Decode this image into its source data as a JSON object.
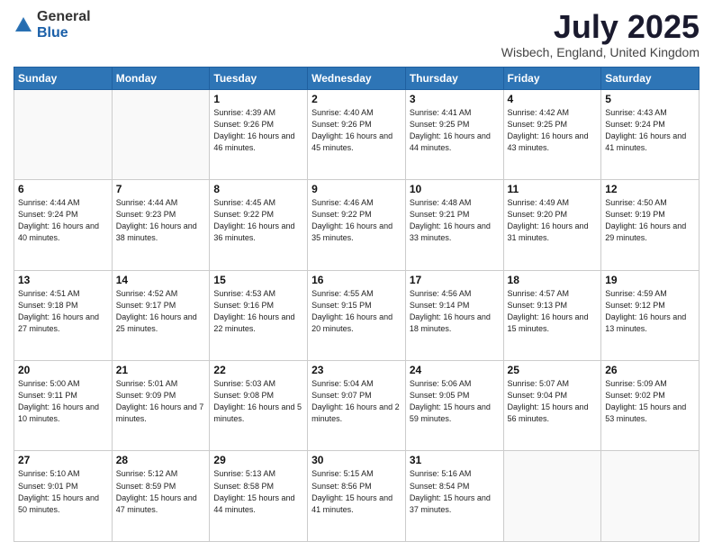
{
  "header": {
    "logo_general": "General",
    "logo_blue": "Blue",
    "title": "July 2025",
    "location": "Wisbech, England, United Kingdom"
  },
  "weekdays": [
    "Sunday",
    "Monday",
    "Tuesday",
    "Wednesday",
    "Thursday",
    "Friday",
    "Saturday"
  ],
  "weeks": [
    [
      {
        "day": "",
        "info": ""
      },
      {
        "day": "",
        "info": ""
      },
      {
        "day": "1",
        "info": "Sunrise: 4:39 AM\nSunset: 9:26 PM\nDaylight: 16 hours\nand 46 minutes."
      },
      {
        "day": "2",
        "info": "Sunrise: 4:40 AM\nSunset: 9:26 PM\nDaylight: 16 hours\nand 45 minutes."
      },
      {
        "day": "3",
        "info": "Sunrise: 4:41 AM\nSunset: 9:25 PM\nDaylight: 16 hours\nand 44 minutes."
      },
      {
        "day": "4",
        "info": "Sunrise: 4:42 AM\nSunset: 9:25 PM\nDaylight: 16 hours\nand 43 minutes."
      },
      {
        "day": "5",
        "info": "Sunrise: 4:43 AM\nSunset: 9:24 PM\nDaylight: 16 hours\nand 41 minutes."
      }
    ],
    [
      {
        "day": "6",
        "info": "Sunrise: 4:44 AM\nSunset: 9:24 PM\nDaylight: 16 hours\nand 40 minutes."
      },
      {
        "day": "7",
        "info": "Sunrise: 4:44 AM\nSunset: 9:23 PM\nDaylight: 16 hours\nand 38 minutes."
      },
      {
        "day": "8",
        "info": "Sunrise: 4:45 AM\nSunset: 9:22 PM\nDaylight: 16 hours\nand 36 minutes."
      },
      {
        "day": "9",
        "info": "Sunrise: 4:46 AM\nSunset: 9:22 PM\nDaylight: 16 hours\nand 35 minutes."
      },
      {
        "day": "10",
        "info": "Sunrise: 4:48 AM\nSunset: 9:21 PM\nDaylight: 16 hours\nand 33 minutes."
      },
      {
        "day": "11",
        "info": "Sunrise: 4:49 AM\nSunset: 9:20 PM\nDaylight: 16 hours\nand 31 minutes."
      },
      {
        "day": "12",
        "info": "Sunrise: 4:50 AM\nSunset: 9:19 PM\nDaylight: 16 hours\nand 29 minutes."
      }
    ],
    [
      {
        "day": "13",
        "info": "Sunrise: 4:51 AM\nSunset: 9:18 PM\nDaylight: 16 hours\nand 27 minutes."
      },
      {
        "day": "14",
        "info": "Sunrise: 4:52 AM\nSunset: 9:17 PM\nDaylight: 16 hours\nand 25 minutes."
      },
      {
        "day": "15",
        "info": "Sunrise: 4:53 AM\nSunset: 9:16 PM\nDaylight: 16 hours\nand 22 minutes."
      },
      {
        "day": "16",
        "info": "Sunrise: 4:55 AM\nSunset: 9:15 PM\nDaylight: 16 hours\nand 20 minutes."
      },
      {
        "day": "17",
        "info": "Sunrise: 4:56 AM\nSunset: 9:14 PM\nDaylight: 16 hours\nand 18 minutes."
      },
      {
        "day": "18",
        "info": "Sunrise: 4:57 AM\nSunset: 9:13 PM\nDaylight: 16 hours\nand 15 minutes."
      },
      {
        "day": "19",
        "info": "Sunrise: 4:59 AM\nSunset: 9:12 PM\nDaylight: 16 hours\nand 13 minutes."
      }
    ],
    [
      {
        "day": "20",
        "info": "Sunrise: 5:00 AM\nSunset: 9:11 PM\nDaylight: 16 hours\nand 10 minutes."
      },
      {
        "day": "21",
        "info": "Sunrise: 5:01 AM\nSunset: 9:09 PM\nDaylight: 16 hours\nand 7 minutes."
      },
      {
        "day": "22",
        "info": "Sunrise: 5:03 AM\nSunset: 9:08 PM\nDaylight: 16 hours\nand 5 minutes."
      },
      {
        "day": "23",
        "info": "Sunrise: 5:04 AM\nSunset: 9:07 PM\nDaylight: 16 hours\nand 2 minutes."
      },
      {
        "day": "24",
        "info": "Sunrise: 5:06 AM\nSunset: 9:05 PM\nDaylight: 15 hours\nand 59 minutes."
      },
      {
        "day": "25",
        "info": "Sunrise: 5:07 AM\nSunset: 9:04 PM\nDaylight: 15 hours\nand 56 minutes."
      },
      {
        "day": "26",
        "info": "Sunrise: 5:09 AM\nSunset: 9:02 PM\nDaylight: 15 hours\nand 53 minutes."
      }
    ],
    [
      {
        "day": "27",
        "info": "Sunrise: 5:10 AM\nSunset: 9:01 PM\nDaylight: 15 hours\nand 50 minutes."
      },
      {
        "day": "28",
        "info": "Sunrise: 5:12 AM\nSunset: 8:59 PM\nDaylight: 15 hours\nand 47 minutes."
      },
      {
        "day": "29",
        "info": "Sunrise: 5:13 AM\nSunset: 8:58 PM\nDaylight: 15 hours\nand 44 minutes."
      },
      {
        "day": "30",
        "info": "Sunrise: 5:15 AM\nSunset: 8:56 PM\nDaylight: 15 hours\nand 41 minutes."
      },
      {
        "day": "31",
        "info": "Sunrise: 5:16 AM\nSunset: 8:54 PM\nDaylight: 15 hours\nand 37 minutes."
      },
      {
        "day": "",
        "info": ""
      },
      {
        "day": "",
        "info": ""
      }
    ]
  ]
}
